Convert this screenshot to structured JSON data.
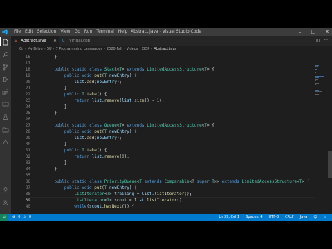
{
  "window": {
    "title": "Abstract.java - Visual Studio Code"
  },
  "menu": [
    "File",
    "Edit",
    "Selection",
    "View",
    "Go",
    "Run",
    "Terminal",
    "Help"
  ],
  "tabs": [
    {
      "label": "Abstract.java",
      "active": true
    },
    {
      "label": "Virtual.cpp",
      "active": false
    }
  ],
  "breadcrumb": [
    "G:",
    "My Drive",
    "SU",
    "7 Programming Languages",
    "2020-Fall",
    "Videos",
    "OOP",
    "Abstract.java"
  ],
  "editor": {
    "current_line": 39,
    "lines": [
      {
        "n": 16,
        "t": "    }"
      },
      {
        "n": 17,
        "t": ""
      },
      {
        "n": 18,
        "t": "    public static class Stack<T> extends LimitedAccessStructure<T> {"
      },
      {
        "n": 19,
        "t": "        public void put(T newEntry) {"
      },
      {
        "n": 20,
        "t": "            list.add(newEntry);"
      },
      {
        "n": 21,
        "t": "        }"
      },
      {
        "n": 22,
        "t": "        public T take() {"
      },
      {
        "n": 23,
        "t": "            return list.remove(list.size() - 1);"
      },
      {
        "n": 24,
        "t": "        }"
      },
      {
        "n": 25,
        "t": "    }"
      },
      {
        "n": 26,
        "t": ""
      },
      {
        "n": 27,
        "t": "    public static class Queue<T> extends LimitedAccessStructure<T> {"
      },
      {
        "n": 28,
        "t": "        public void put(T newEntry) {"
      },
      {
        "n": 29,
        "t": "            list.add(newEntry);"
      },
      {
        "n": 30,
        "t": "        }"
      },
      {
        "n": 31,
        "t": "        public T take() {"
      },
      {
        "n": 32,
        "t": "            return list.remove(0);"
      },
      {
        "n": 33,
        "t": "        }"
      },
      {
        "n": 34,
        "t": "    }"
      },
      {
        "n": 35,
        "t": ""
      },
      {
        "n": 36,
        "t": "    public static class PriorityQueue<T extends Comparable<? super T>> extends LimitedAccessStructure<T> {"
      },
      {
        "n": 37,
        "t": "        public void put(T newEntry) {"
      },
      {
        "n": 38,
        "t": "            ListIterator<T> trailing = list.listIterator();"
      },
      {
        "n": 39,
        "t": "            ListIterator<T> scout = list.listIterator();"
      },
      {
        "n": 40,
        "t": "            while(scout.hasNext()) {"
      }
    ]
  },
  "status": {
    "errors": "0",
    "warnings": "0",
    "position": "Ln 39, Col 1",
    "spaces": "Spaces: 4",
    "encoding": "UTF-8",
    "eol": "CRLF",
    "language": "Java"
  },
  "colors": {
    "keyword": "#569cd6",
    "type": "#4ec9b0",
    "function": "#dcdcaa",
    "variable": "#9cdcfe",
    "number": "#b5cea8",
    "statusbar": "#007acc"
  }
}
